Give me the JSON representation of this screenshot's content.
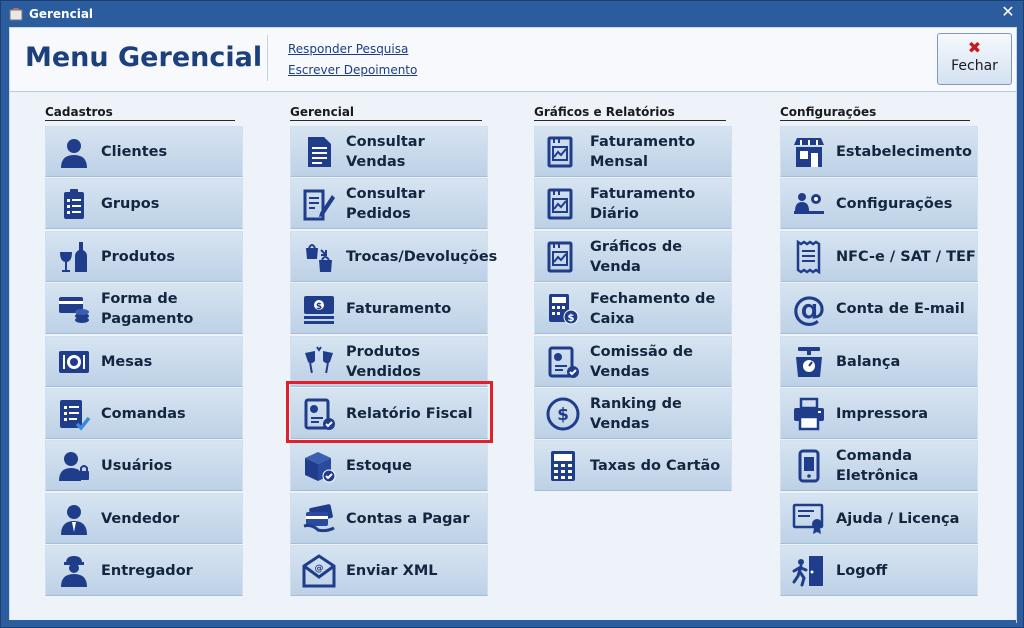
{
  "window": {
    "title": "Gerencial",
    "close_glyph": "✕"
  },
  "header": {
    "title": "Menu Gerencial",
    "links": [
      "Responder Pesquisa",
      "Escrever Depoimento"
    ],
    "close_button": {
      "label": "Fechar",
      "icon": "✖"
    }
  },
  "colors": {
    "accent": "#1c3f7d",
    "titlebar": "#2b5d9e",
    "highlight": "#e0202a",
    "tile": "#c8d9eb"
  },
  "columns": [
    {
      "title": "Cadastros",
      "items": [
        {
          "label": "Clientes",
          "icon": "user-icon"
        },
        {
          "label": "Grupos",
          "icon": "clipboard-list-icon"
        },
        {
          "label": "Produtos",
          "icon": "wine-bottle-icon"
        },
        {
          "label": "Forma de\nPagamento",
          "icon": "credit-card-coins-icon"
        },
        {
          "label": "Mesas",
          "icon": "plate-cutlery-icon"
        },
        {
          "label": "Comandas",
          "icon": "checklist-icon"
        },
        {
          "label": "Usuários",
          "icon": "user-lock-icon"
        },
        {
          "label": "Vendedor",
          "icon": "salesperson-icon"
        },
        {
          "label": "Entregador",
          "icon": "delivery-person-icon"
        }
      ]
    },
    {
      "title": "Gerencial",
      "items": [
        {
          "label": "Consultar Vendas",
          "icon": "document-icon"
        },
        {
          "label": "Consultar Pedidos",
          "icon": "document-edit-icon"
        },
        {
          "label": "Trocas/Devoluções",
          "icon": "shopping-bags-icon"
        },
        {
          "label": "Faturamento",
          "icon": "money-stack-icon"
        },
        {
          "label": "Produtos Vendidos",
          "icon": "toast-glasses-icon"
        },
        {
          "label": "Relatório Fiscal",
          "icon": "report-check-icon"
        },
        {
          "label": "Estoque",
          "icon": "box-check-icon"
        },
        {
          "label": "Contas a Pagar",
          "icon": "cards-hand-icon"
        },
        {
          "label": "Enviar XML",
          "icon": "envelope-at-icon"
        }
      ]
    },
    {
      "title": "Gráficos e Relatórios",
      "items": [
        {
          "label": "Faturamento\nMensal",
          "icon": "chart-document-icon"
        },
        {
          "label": "Faturamento\nDiário",
          "icon": "chart-document-icon"
        },
        {
          "label": "Gráficos de Venda",
          "icon": "chart-document-icon"
        },
        {
          "label": "Fechamento de\nCaixa",
          "icon": "calculator-dollar-icon"
        },
        {
          "label": "Comissão de\nVendas",
          "icon": "report-check-icon"
        },
        {
          "label": "Ranking de\nVendas",
          "icon": "dollar-circle-icon"
        },
        {
          "label": "Taxas do Cartão",
          "icon": "calculator-icon"
        }
      ]
    },
    {
      "title": "Configurações",
      "items": [
        {
          "label": "Estabelecimento",
          "icon": "storefront-icon"
        },
        {
          "label": "Configurações",
          "icon": "people-settings-icon"
        },
        {
          "label": "NFC-e / SAT / TEF",
          "icon": "receipt-icon"
        },
        {
          "label": "Conta de E-mail",
          "icon": "at-sign-icon"
        },
        {
          "label": "Balança",
          "icon": "scale-icon"
        },
        {
          "label": "Impressora",
          "icon": "printer-icon"
        },
        {
          "label": "Comanda\nEletrônica",
          "icon": "mobile-device-icon"
        },
        {
          "label": "Ajuda / Licença",
          "icon": "certificate-icon"
        },
        {
          "label": "Logoff",
          "icon": "exit-door-icon"
        }
      ]
    }
  ]
}
